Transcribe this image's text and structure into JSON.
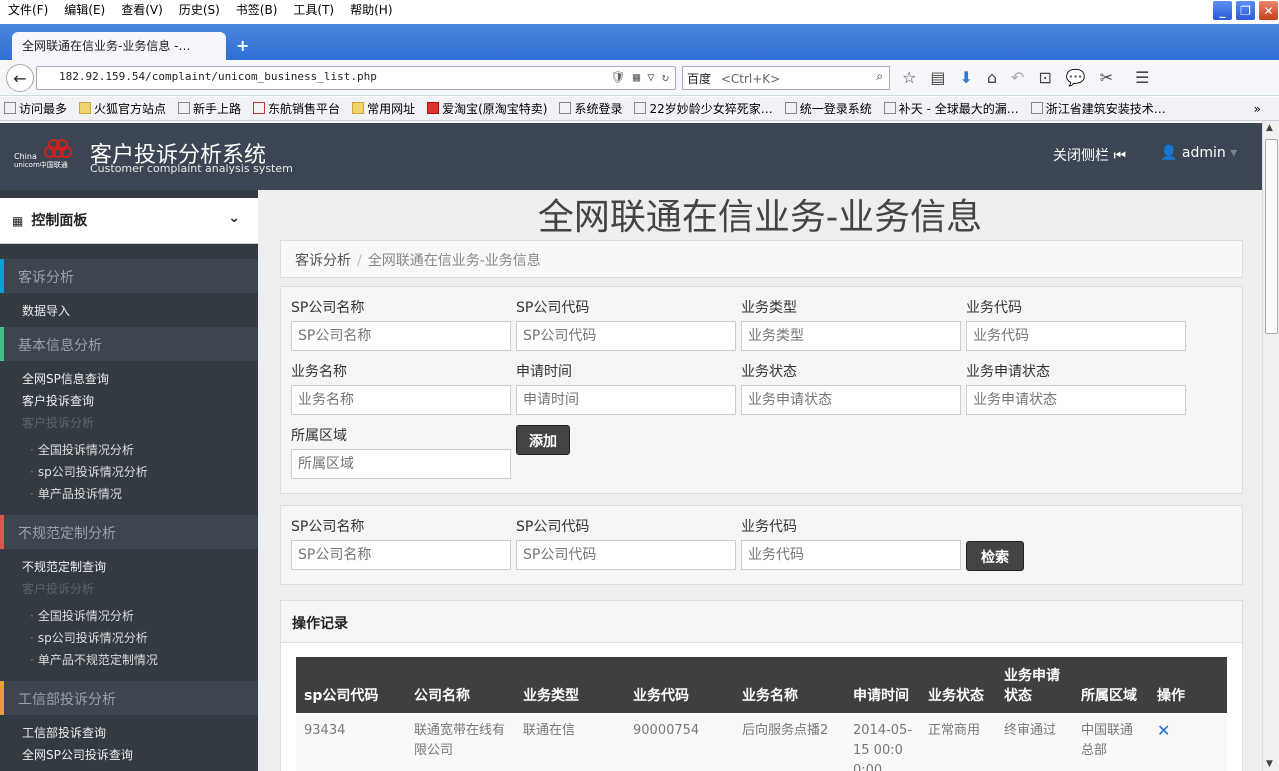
{
  "browser": {
    "menu": [
      "文件(F)",
      "编辑(E)",
      "查看(V)",
      "历史(S)",
      "书签(B)",
      "工具(T)",
      "帮助(H)"
    ],
    "tab_title": "全网联通在信业务-业务信息 -…",
    "url": "182.92.159.54/complaint/unicom_business_list.php",
    "search_engine": "百度",
    "search_placeholder": "<Ctrl+K>",
    "bookmarks": [
      "访问最多",
      "火狐官方站点",
      "新手上路",
      "东航销售平台",
      "常用网址",
      "爱淘宝(原淘宝特卖)",
      "系统登录",
      "22岁妙龄少女猝死家…",
      "统一登录系统",
      "补天 - 全球最大的漏…",
      "浙江省建筑安装技术…"
    ]
  },
  "header": {
    "logo_text": "China unicom中国联通",
    "title": "客户投诉分析系统",
    "subtitle": "Customer complaint analysis system",
    "close_sidebar": "关闭侧栏",
    "user": "admin"
  },
  "sidebar": {
    "dashboard": "控制面板",
    "sections": [
      {
        "title": "客诉分析",
        "items": [
          "数据导入"
        ]
      },
      {
        "title": "基本信息分析",
        "items": [
          "全网SP信息查询",
          "客户投诉查询"
        ],
        "dim": "客户投诉分析",
        "subs": [
          "全国投诉情况分析",
          "sp公司投诉情况分析",
          "单产品投诉情况"
        ]
      },
      {
        "title": "不规范定制分析",
        "items": [
          "不规范定制查询"
        ],
        "dim": "客户投诉分析",
        "subs": [
          "全国投诉情况分析",
          "sp公司投诉情况分析",
          "单产品不规范定制情况"
        ]
      },
      {
        "title": "工信部投诉分析",
        "items": [
          "工信部投诉查询",
          "全网SP公司投诉查询"
        ]
      }
    ]
  },
  "main": {
    "page_title": "全网联通在信业务-业务信息",
    "breadcrumb": [
      "客诉分析",
      "全网联通在信业务-业务信息"
    ],
    "add_form": {
      "fields": [
        {
          "label": "SP公司名称",
          "placeholder": "SP公司名称"
        },
        {
          "label": "SP公司代码",
          "placeholder": "SP公司代码"
        },
        {
          "label": "业务类型",
          "placeholder": "业务类型"
        },
        {
          "label": "业务代码",
          "placeholder": "业务代码"
        },
        {
          "label": "业务名称",
          "placeholder": "业务名称"
        },
        {
          "label": "申请时间",
          "placeholder": "申请时间"
        },
        {
          "label": "业务状态",
          "placeholder": "业务申请状态"
        },
        {
          "label": "业务申请状态",
          "placeholder": "业务申请状态"
        },
        {
          "label": "所属区域",
          "placeholder": "所属区域"
        }
      ],
      "button": "添加"
    },
    "search_form": {
      "fields": [
        {
          "label": "SP公司名称",
          "placeholder": "SP公司名称"
        },
        {
          "label": "SP公司代码",
          "placeholder": "SP公司代码"
        },
        {
          "label": "业务代码",
          "placeholder": "业务代码"
        }
      ],
      "button": "检索"
    },
    "records": {
      "title": "操作记录",
      "columns": [
        "sp公司代码",
        "公司名称",
        "业务类型",
        "业务代码",
        "业务名称",
        "申请时间",
        "业务状态",
        "业务申请状态",
        "所属区域",
        "操作"
      ],
      "rows": [
        [
          "93434",
          "联通宽带在线有限公司",
          "联通在信",
          "90000754",
          "后向服务点播2",
          "2014-05-15 00:00:00",
          "正常商用",
          "终审通过",
          "中国联通总部",
          "✕"
        ]
      ]
    }
  }
}
